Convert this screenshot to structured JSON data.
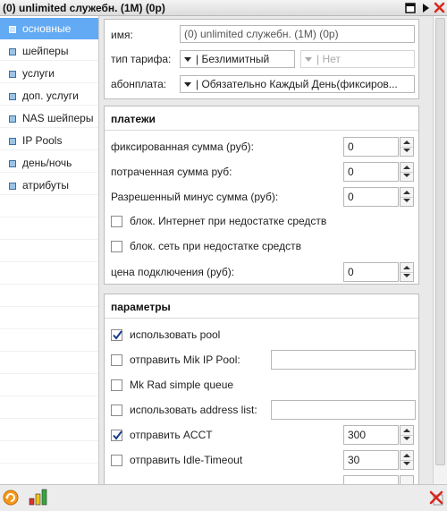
{
  "window": {
    "title": "(0) unlimited служебн. (1M) (0p)",
    "icons": [
      "window-icon",
      "play-icon",
      "close-icon"
    ]
  },
  "sidebar": {
    "items": [
      {
        "label": "основные",
        "active": true
      },
      {
        "label": "шейперы"
      },
      {
        "label": "услуги"
      },
      {
        "label": "доп. услуги"
      },
      {
        "label": "NAS шейперы"
      },
      {
        "label": "IP Pools"
      },
      {
        "label": "день/ночь"
      },
      {
        "label": "атрибуты"
      }
    ]
  },
  "general": {
    "name_label": "имя:",
    "name_value": "(0) unlimited служебн. (1M) (0p)",
    "tariff_type_label": "тип тарифа:",
    "tariff_type_value": "| Безлимитный",
    "tariff_type2_value": "| Нет",
    "fee_label": "абонплата:",
    "fee_value": "| Обязательно Каждый День(фиксиров..."
  },
  "payments": {
    "title": "платежи",
    "fixed_label": "фиксированная сумма (руб):",
    "fixed_value": "0",
    "spent_label": "потраченная сумма руб:",
    "spent_value": "0",
    "minus_label": "Разрешенный минус сумма (руб):",
    "minus_value": "0",
    "block_inet_label": "блок. Интернет при недостатке средств",
    "block_inet_checked": false,
    "block_net_label": "блок. сеть при недостатке средств",
    "block_net_checked": false,
    "connect_label": "цена подключения (руб):",
    "connect_value": "0"
  },
  "params": {
    "title": "параметры",
    "use_pool_label": "использовать pool",
    "use_pool_checked": true,
    "mik_pool_label": "отправить Mik IP Pool:",
    "mik_pool_checked": false,
    "mik_pool_value": "",
    "simple_queue_label": "Mk Rad simple queue",
    "simple_queue_checked": false,
    "address_list_label": "использовать address list:",
    "address_list_checked": false,
    "address_list_value": "",
    "acct_label": "отправить ACCT",
    "acct_checked": true,
    "acct_value": "300",
    "idle_label": "отправить Idle-Timeout",
    "idle_checked": false,
    "idle_value": "30"
  },
  "colors": {
    "active_item": "#62aaf3",
    "check": "#1a3a8a",
    "close": "#d9261c"
  }
}
